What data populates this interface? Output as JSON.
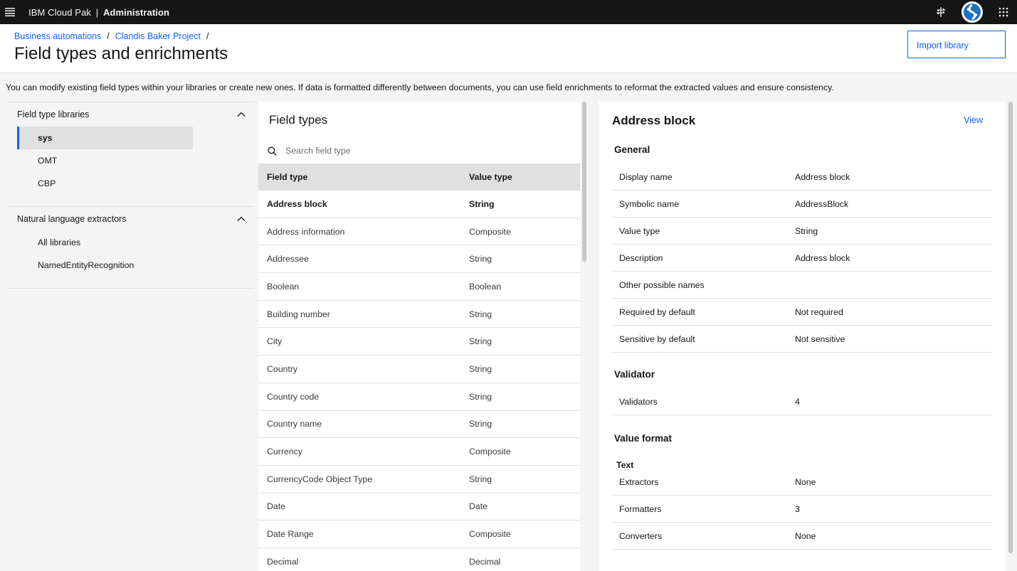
{
  "app": {
    "brand_prefix": "IBM Cloud Pak",
    "brand_separator": "|",
    "brand_section": "Administration"
  },
  "breadcrumb": {
    "items": [
      "Business automations",
      "Clandis Baker Project"
    ],
    "separator": "/"
  },
  "page": {
    "title": "Field types and enrichments",
    "import_label": "Import library",
    "intro": "You can modify existing field types within your libraries or create new ones. If data is formatted differently between documents, you can use field enrichments to reformat the extracted values and ensure consistency."
  },
  "sidebar": {
    "sections": [
      {
        "title": "Field type libraries",
        "items": [
          "sys",
          "OMT",
          "CBP"
        ],
        "active": "sys"
      },
      {
        "title": "Natural language extractors",
        "items": [
          "All libraries",
          "NamedEntityRecognition"
        ]
      }
    ]
  },
  "field_types": {
    "title": "Field types",
    "search_placeholder": "Search field type",
    "columns": [
      "Field type",
      "Value type"
    ],
    "rows": [
      [
        "Address block",
        "String"
      ],
      [
        "Address information",
        "Composite"
      ],
      [
        "Addressee",
        "String"
      ],
      [
        "Boolean",
        "Boolean"
      ],
      [
        "Building number",
        "String"
      ],
      [
        "City",
        "String"
      ],
      [
        "Country",
        "String"
      ],
      [
        "Country code",
        "String"
      ],
      [
        "Country name",
        "String"
      ],
      [
        "Currency",
        "Composite"
      ],
      [
        "CurrencyCode Object Type",
        "String"
      ],
      [
        "Date",
        "Date"
      ],
      [
        "Date Range",
        "Composite"
      ],
      [
        "Decimal",
        "Decimal"
      ]
    ]
  },
  "detail": {
    "title": "Address block",
    "view_label": "View",
    "general_title": "General",
    "general": [
      [
        "Display name",
        "Address block"
      ],
      [
        "Symbolic name",
        "AddressBlock"
      ],
      [
        "Value type",
        "String"
      ],
      [
        "Description",
        "Address block"
      ],
      [
        "Other possible names",
        ""
      ],
      [
        "Required by default",
        "Not required"
      ],
      [
        "Sensitive by default",
        "Not sensitive"
      ]
    ],
    "validator_title": "Validator",
    "validator": [
      [
        "Validators",
        "4"
      ]
    ],
    "value_format_title": "Value format",
    "text_label": "Text",
    "value_format": [
      [
        "Extractors",
        "None"
      ],
      [
        "Formatters",
        "3"
      ],
      [
        "Converters",
        "None"
      ]
    ]
  },
  "colors": {
    "accent": "#0f62fe",
    "topbar": "#161616",
    "page_bg": "#f4f4f4",
    "row_border": "#e0e0e0"
  },
  "icons": [
    "menu-icon",
    "pin-icon",
    "avatar-icon",
    "app-switcher-icon",
    "chevron-up-icon",
    "search-icon"
  ]
}
